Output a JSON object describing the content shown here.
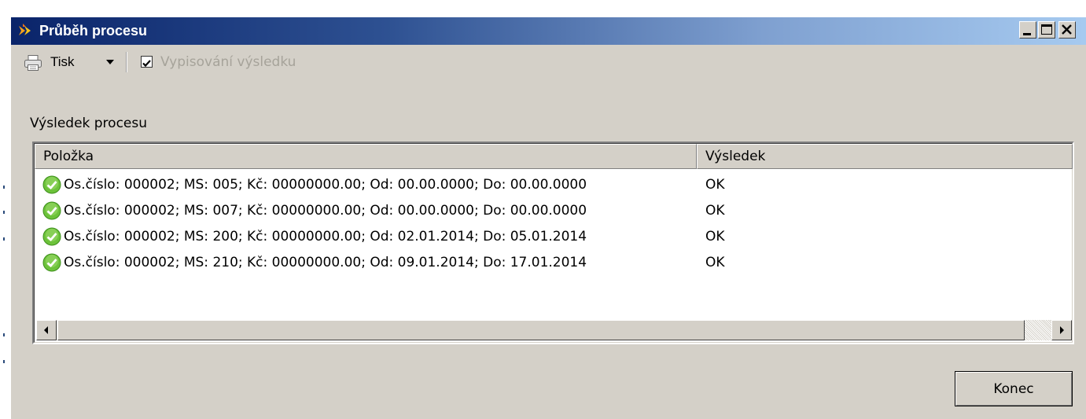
{
  "window": {
    "title": "Průběh procesu"
  },
  "toolbar": {
    "print_label": "Tisk",
    "checkbox_label": "Vypisování výsledku",
    "checkbox_checked": true
  },
  "section": {
    "label": "Výsledek procesu"
  },
  "table": {
    "columns": [
      "Položka",
      "Výsledek"
    ],
    "rows": [
      {
        "item": "Os.číslo: 000002; MS: 005; Kč: 00000000.00; Od: 00.00.0000; Do: 00.00.0000",
        "result": "OK"
      },
      {
        "item": "Os.číslo: 000002; MS: 007; Kč: 00000000.00; Od: 00.00.0000; Do: 00.00.0000",
        "result": "OK"
      },
      {
        "item": "Os.číslo: 000002; MS: 200; Kč: 00000000.00; Od: 02.01.2014; Do: 05.01.2014",
        "result": "OK"
      },
      {
        "item": "Os.číslo: 000002; MS: 210; Kč: 00000000.00; Od: 09.01.2014; Do: 17.01.2014",
        "result": "OK"
      }
    ]
  },
  "buttons": {
    "close_label": "Konec"
  },
  "colors": {
    "titlebar_start": "#0a246a",
    "titlebar_end": "#a6caf0",
    "window_bg": "#d4d0c8",
    "ok_green": "#5cb82e"
  }
}
